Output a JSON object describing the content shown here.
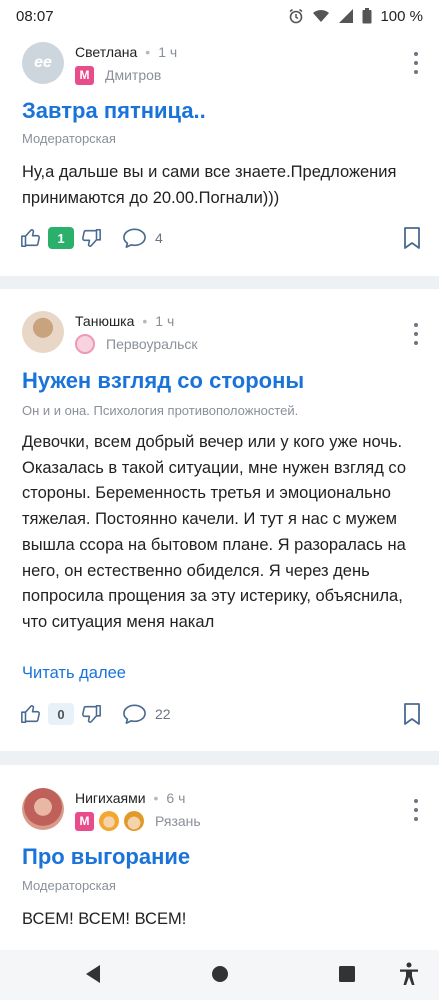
{
  "status_bar": {
    "time": "08:07",
    "battery": "100 %"
  },
  "posts": [
    {
      "author": "Светлана",
      "avatar_text": "ее",
      "time": "1 ч",
      "badges": [
        "М"
      ],
      "city": "Дмитров",
      "title": "Завтра пятница..",
      "rubric": "Модераторская",
      "text": "Ну,а дальше вы и сами все знаете.Предложения принимаются до 20.00.Погнали)))",
      "likes": "1",
      "comments": "4"
    },
    {
      "author": "Танюшка",
      "time": "1 ч",
      "city": "Первоуральск",
      "title": "Нужен взгляд со стороны",
      "rubric": "Он и и она. Психология противоположностей.",
      "text": "Девочки, всем добрый вечер или у кого уже ночь. Оказалась в такой ситуации, мне нужен взгляд со стороны. Беременность третья и эмоционально тяжелая. Постоянно качели. И тут я нас с мужем вышла ссора на бытовом плане. Я разоралась на него, он естественно обиделся. Я через день попросила прощения за эту истерику, объяснила, что ситуация меня накал",
      "read_more": "Читать далее",
      "likes": "0",
      "comments": "22"
    },
    {
      "author": "Нигихаями",
      "time": "6 ч",
      "badges": [
        "М"
      ],
      "city": "Рязань",
      "title": "Про выгорание",
      "rubric": "Модераторская",
      "text": "ВСЕМ! ВСЕМ! ВСЕМ!"
    }
  ],
  "icons": {
    "like": "thumb-up-icon",
    "dislike": "thumb-down-icon",
    "comment": "comment-bubble-icon",
    "bookmark": "bookmark-icon",
    "menu": "more-vertical-icon"
  },
  "colors": {
    "accent": "#1a73d9",
    "like_active": "#2ab06a",
    "badge_m": "#e84c8b"
  }
}
